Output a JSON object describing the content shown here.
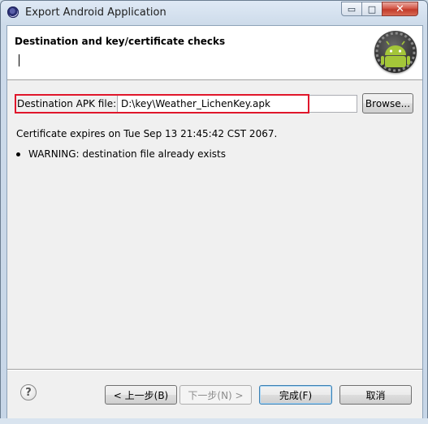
{
  "window": {
    "title": "Export Android Application",
    "controls": {
      "minimize": "▭",
      "maximize": "□",
      "close": "✕"
    }
  },
  "banner": {
    "title": "Destination and key/certificate checks",
    "icon": "android-logo-icon"
  },
  "apk": {
    "label": "Destination APK file:",
    "value": "D:\\key\\Weather_LichenKey.apk",
    "browse_label": "Browse..."
  },
  "messages": {
    "certificate": "Certificate expires on Tue Sep 13 21:45:42 CST 2067.",
    "warning": "WARNING: destination file already exists"
  },
  "footer": {
    "help_icon": "?",
    "back_label": "< 上一步(B)",
    "next_label": "下一步(N) >",
    "finish_label": "完成(F)",
    "cancel_label": "取消"
  },
  "colors": {
    "highlight": "#e0162b",
    "android_green": "#a4c639"
  }
}
